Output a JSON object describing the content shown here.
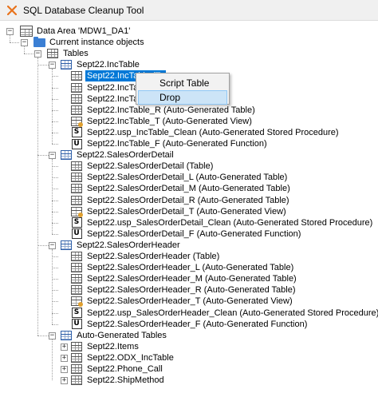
{
  "window": {
    "title": "SQL Database Cleanup Tool",
    "app_icon": "close-x-icon"
  },
  "tree": {
    "root": "Data Area 'MDW1_DA1'",
    "instance": "Current instance objects",
    "tables_folder": "Tables",
    "groups": [
      {
        "label": "Sept22.IncTable",
        "children": [
          {
            "label": "Sept22.IncTable (Table)",
            "icon": "table",
            "selected": true,
            "visible_label": "Sept22.IncTable (Ta"
          },
          {
            "label": "Sept22.IncTable_L (Auto-Generated Table)",
            "icon": "table",
            "visible_label": "Sept22.IncTab"
          },
          {
            "label": "Sept22.IncTable_M (Auto-Generated Table)",
            "icon": "table",
            "visible_label": "Sept22.IncTab"
          },
          {
            "label": "Sept22.IncTable_R (Auto-Generated Table)",
            "icon": "table"
          },
          {
            "label": "Sept22.IncTable_T (Auto-Generated View)",
            "icon": "view"
          },
          {
            "label": "Sept22.usp_IncTable_Clean (Auto-Generated Stored Procedure)",
            "icon": "S"
          },
          {
            "label": "Sept22.IncTable_F (Auto-Generated Function)",
            "icon": "U"
          }
        ]
      },
      {
        "label": "Sept22.SalesOrderDetail",
        "children": [
          {
            "label": "Sept22.SalesOrderDetail (Table)",
            "icon": "table"
          },
          {
            "label": "Sept22.SalesOrderDetail_L (Auto-Generated Table)",
            "icon": "table"
          },
          {
            "label": "Sept22.SalesOrderDetail_M (Auto-Generated Table)",
            "icon": "table"
          },
          {
            "label": "Sept22.SalesOrderDetail_R (Auto-Generated Table)",
            "icon": "table"
          },
          {
            "label": "Sept22.SalesOrderDetail_T (Auto-Generated View)",
            "icon": "view"
          },
          {
            "label": "Sept22.usp_SalesOrderDetail_Clean (Auto-Generated Stored Procedure)",
            "icon": "S"
          },
          {
            "label": "Sept22.SalesOrderDetail_F (Auto-Generated Function)",
            "icon": "U"
          }
        ]
      },
      {
        "label": "Sept22.SalesOrderHeader",
        "children": [
          {
            "label": "Sept22.SalesOrderHeader (Table)",
            "icon": "table"
          },
          {
            "label": "Sept22.SalesOrderHeader_L (Auto-Generated Table)",
            "icon": "table"
          },
          {
            "label": "Sept22.SalesOrderHeader_M (Auto-Generated Table)",
            "icon": "table"
          },
          {
            "label": "Sept22.SalesOrderHeader_R (Auto-Generated Table)",
            "icon": "table"
          },
          {
            "label": "Sept22.SalesOrderHeader_T (Auto-Generated View)",
            "icon": "view"
          },
          {
            "label": "Sept22.usp_SalesOrderHeader_Clean (Auto-Generated Stored Procedure)",
            "icon": "S"
          },
          {
            "label": "Sept22.SalesOrderHeader_F (Auto-Generated Function)",
            "icon": "U"
          }
        ]
      }
    ],
    "auto_generated": {
      "label": "Auto-Generated Tables",
      "children": [
        "Sept22.Items",
        "Sept22.ODX_IncTable",
        "Sept22.Phone_Call",
        "Sept22.ShipMethod"
      ]
    }
  },
  "context_menu": {
    "items": [
      {
        "label": "Script Table",
        "highlighted": false
      },
      {
        "label": "Drop",
        "highlighted": true
      }
    ]
  },
  "colors": {
    "selection": "#0078d7",
    "menu_highlight": "#cce4f7",
    "folder": "#3b7fd4"
  }
}
